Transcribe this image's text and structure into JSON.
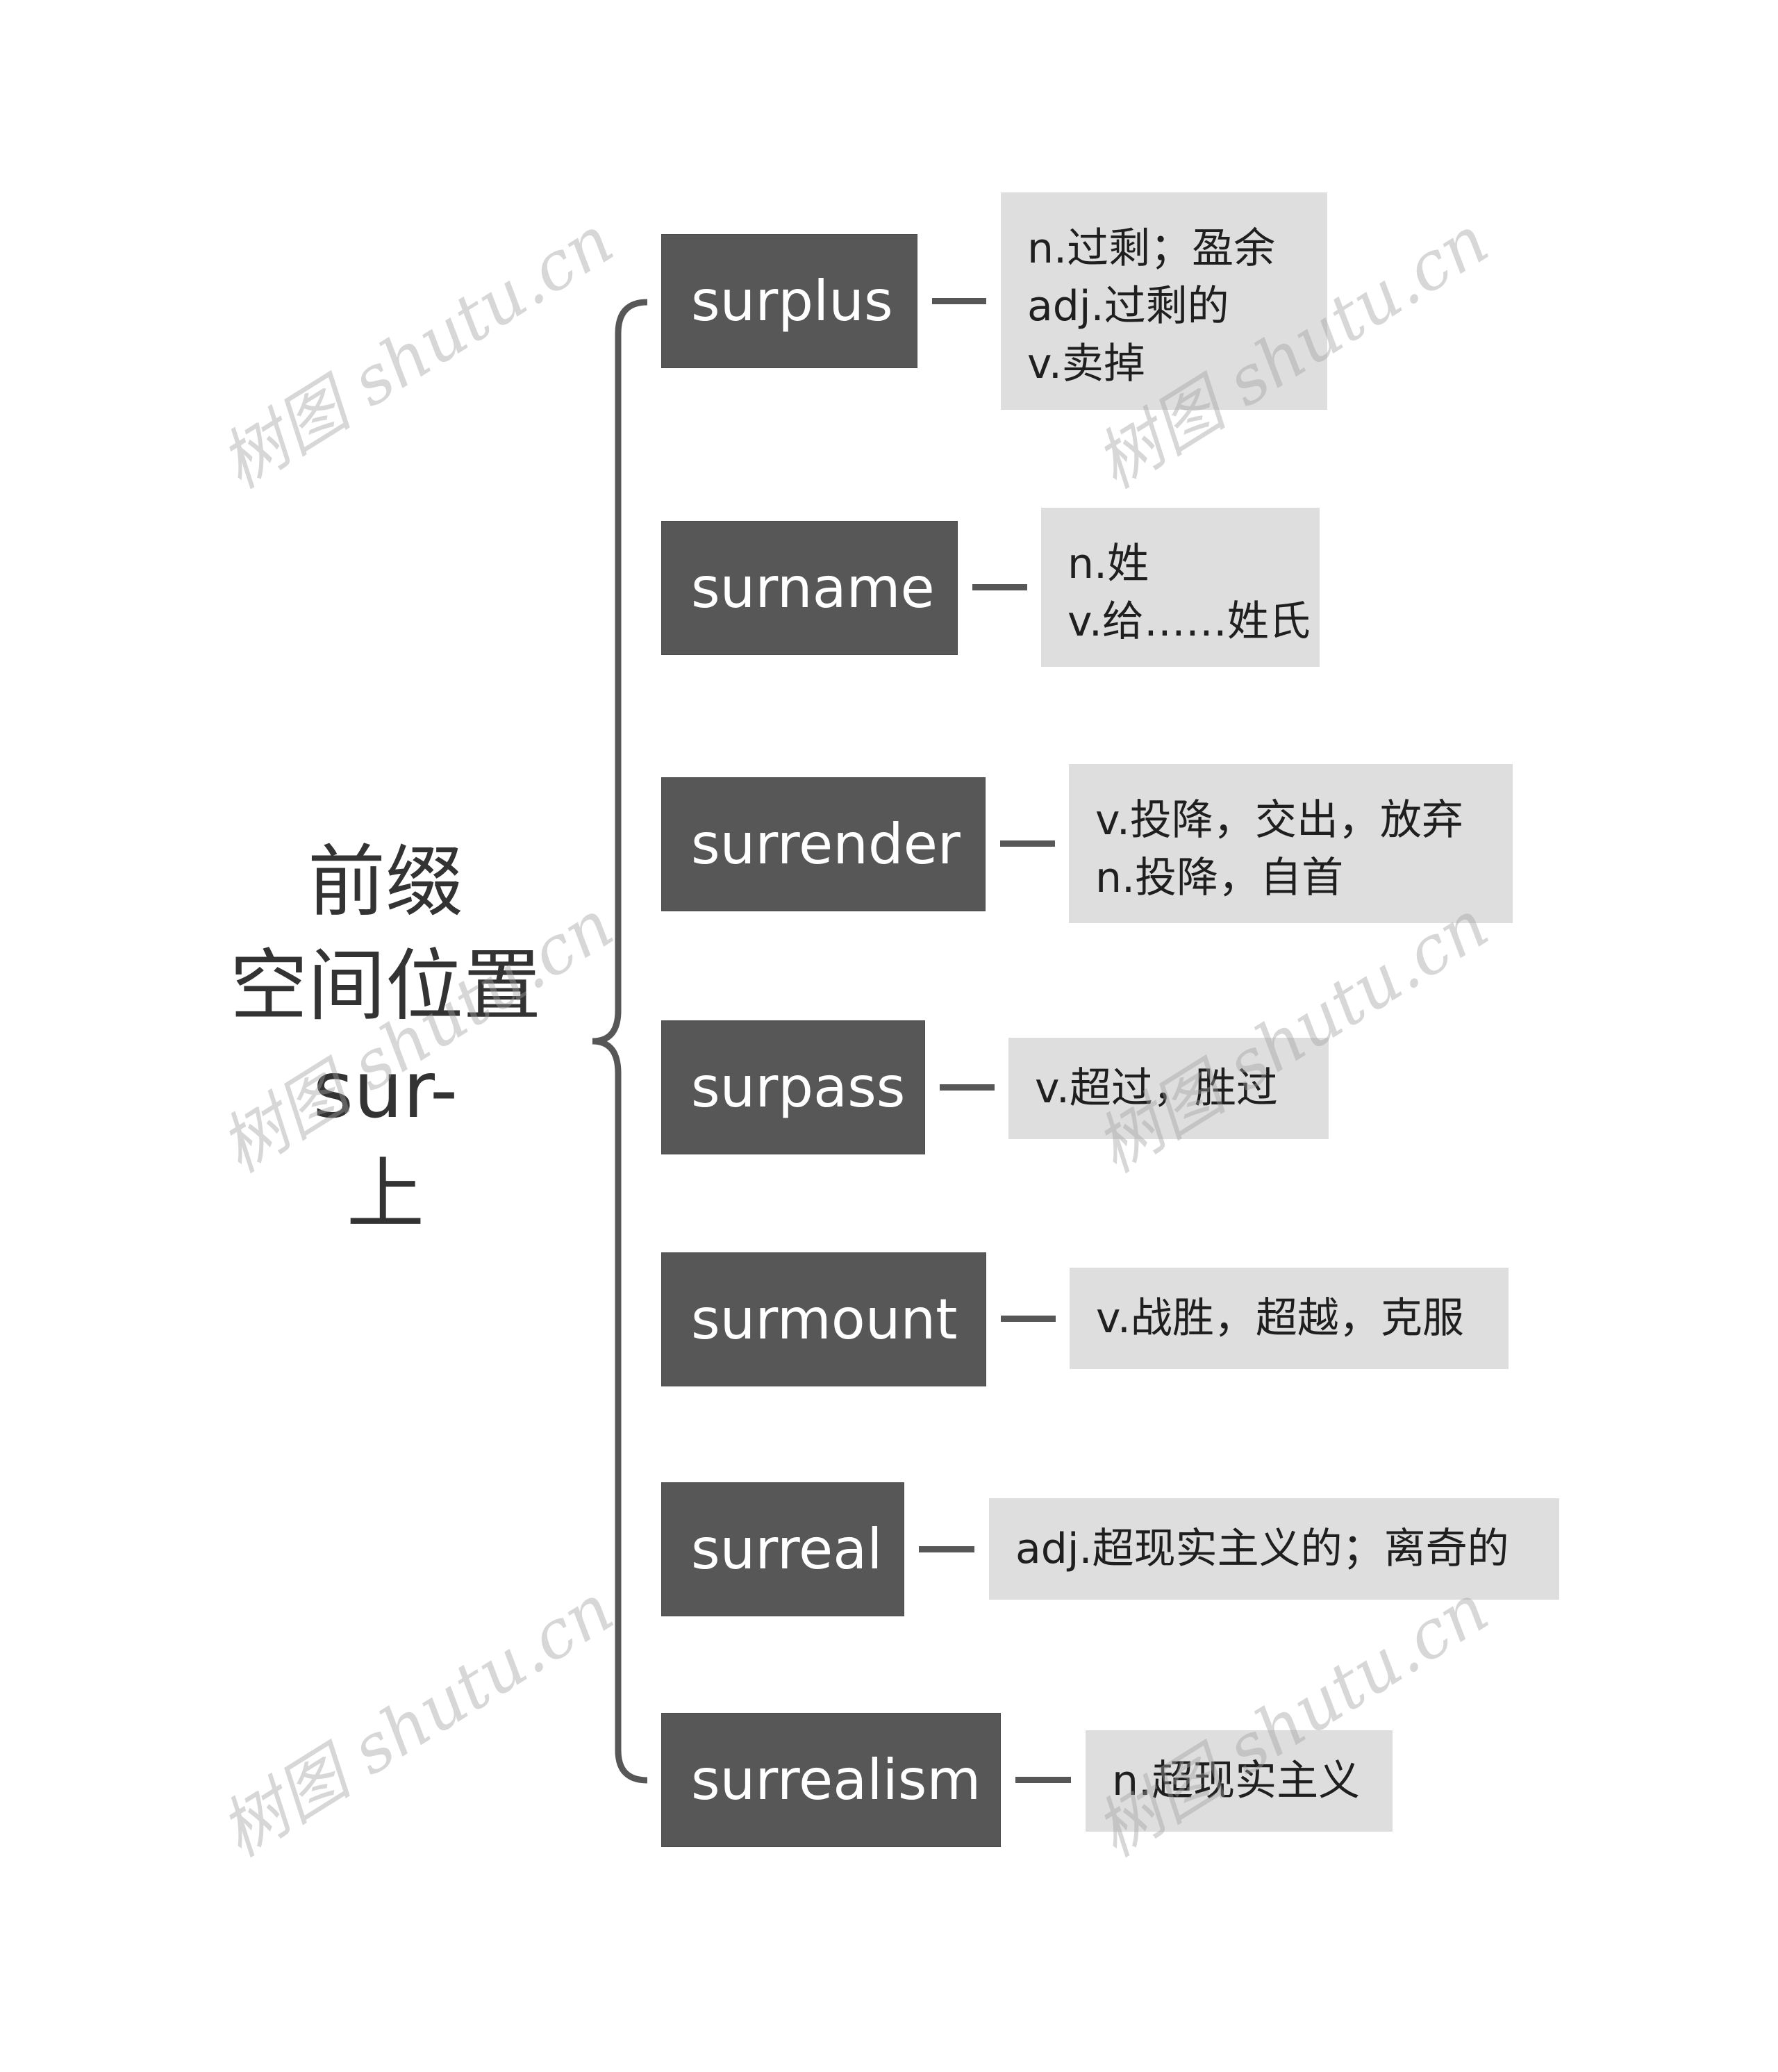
{
  "root": {
    "lines": [
      "前缀",
      "空间位置",
      "sur-",
      "上"
    ]
  },
  "branches": [
    {
      "word": "surplus",
      "definitions": [
        "n.过剩；盈余",
        "adj.过剩的",
        "v.卖掉"
      ]
    },
    {
      "word": "surname",
      "definitions": [
        "n.姓",
        "v.给……姓氏"
      ]
    },
    {
      "word": "surrender",
      "definitions": [
        "v.投降，交出，放弃",
        "n.投降，自首"
      ]
    },
    {
      "word": "surpass",
      "definitions": [
        "v.超过，胜过"
      ]
    },
    {
      "word": "surmount",
      "definitions": [
        "v.战胜，超越，克服"
      ]
    },
    {
      "word": "surreal",
      "definitions": [
        "adj.超现实主义的；离奇的"
      ]
    },
    {
      "word": "surrealism",
      "definitions": [
        "n.超现实主义"
      ]
    }
  ],
  "watermark": {
    "text": "树图 shutu.cn"
  },
  "colors": {
    "word_box": "#575757",
    "definition_box": "#dedede",
    "connector": "#575757",
    "root_text": "#333333"
  }
}
